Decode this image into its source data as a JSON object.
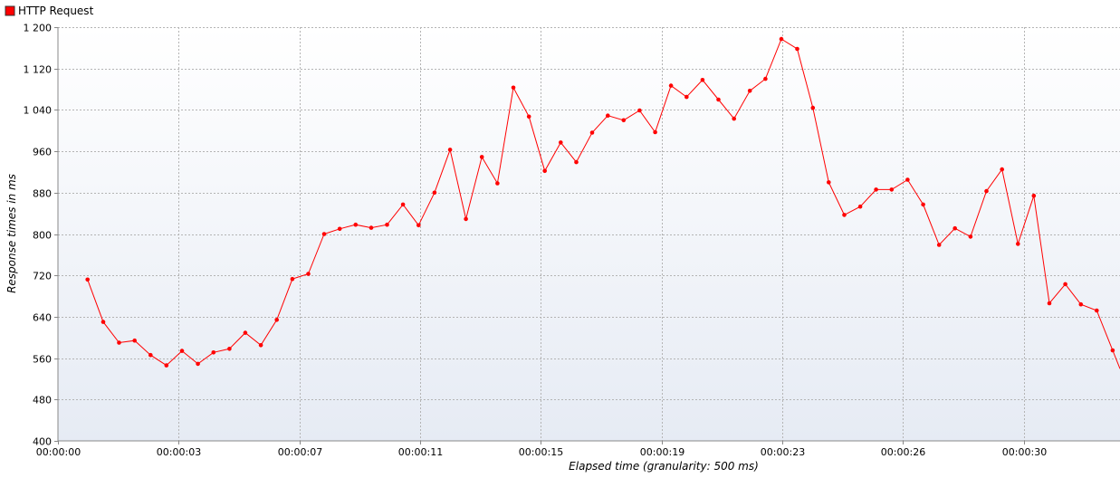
{
  "legend": {
    "label": "HTTP Request",
    "color": "#ff0000"
  },
  "axes": {
    "x_title": "Elapsed time (granularity: 500 ms)",
    "y_title": "Response times in ms"
  },
  "chart_data": {
    "type": "line",
    "title": "",
    "xlabel": "Elapsed time (granularity: 500 ms)",
    "ylabel": "Response times in ms",
    "ylim": [
      400,
      1200
    ],
    "xlim_seconds": [
      0,
      34.75
    ],
    "y_ticks": [
      400,
      480,
      560,
      640,
      720,
      800,
      880,
      960,
      1040,
      1120,
      1200
    ],
    "y_tick_labels": [
      "400",
      "480",
      "560",
      "640",
      "720",
      "800",
      "880",
      "960",
      "1 040",
      "1 120",
      "1 200"
    ],
    "x_ticks_seconds": [
      0,
      3.95,
      7.9,
      11.85,
      15.8,
      19.75,
      23.7,
      27.65,
      31.6
    ],
    "x_tick_labels": [
      "00:00:00",
      "00:00:03",
      "00:00:07",
      "00:00:11",
      "00:00:15",
      "00:00:19",
      "00:00:23",
      "00:00:26",
      "00:00:30"
    ],
    "grid": true,
    "legend_position": "top-left",
    "series": [
      {
        "name": "HTTP Request",
        "color": "#ff0000",
        "x": [
          0.97,
          1.48,
          2.0,
          2.51,
          3.03,
          3.55,
          4.06,
          4.58,
          5.09,
          5.61,
          6.13,
          6.64,
          7.16,
          7.67,
          8.19,
          8.71,
          9.22,
          9.74,
          10.25,
          10.77,
          11.29,
          11.8,
          12.32,
          12.83,
          13.35,
          13.87,
          14.38,
          14.9,
          15.41,
          15.93,
          16.45,
          16.96,
          17.48,
          17.99,
          18.51,
          19.03,
          19.54,
          20.06,
          20.57,
          21.09,
          21.61,
          22.12,
          22.64,
          23.15,
          23.67,
          24.19,
          24.7,
          25.22,
          25.73,
          26.25,
          26.77,
          27.28,
          27.8,
          28.31,
          28.83,
          29.35,
          29.86,
          30.38,
          30.89,
          31.41,
          31.93,
          32.44,
          32.96,
          33.47,
          33.99,
          34.51
        ],
        "y": [
          712,
          630,
          590,
          594,
          566,
          546,
          574,
          549,
          571,
          578,
          609,
          585,
          634,
          713,
          723,
          800,
          810,
          818,
          812,
          818,
          857,
          817,
          880,
          963,
          829,
          949,
          898,
          1083,
          1027,
          922,
          977,
          939,
          996,
          1029,
          1020,
          1039,
          997,
          1087,
          1065,
          1098,
          1060,
          1023,
          1077,
          1100,
          1177,
          1158,
          1044,
          900,
          837,
          853,
          886,
          886,
          905,
          857,
          779,
          811,
          795,
          883,
          925,
          781,
          874,
          666,
          703,
          664,
          652,
          575
        ]
      }
    ]
  }
}
